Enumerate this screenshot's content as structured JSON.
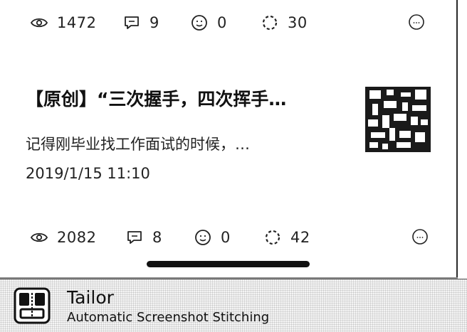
{
  "feed": {
    "top_stats": {
      "views": "1472",
      "comments": "9",
      "likes": "0",
      "shares": "30"
    },
    "article": {
      "title": "【原创】“三次握手，四次挥手…",
      "summary": "记得刚毕业找工作面试的时候，…",
      "date": "2019/1/15  11:10",
      "stats": {
        "views": "2082",
        "comments": "8",
        "likes": "0",
        "shares": "42"
      }
    }
  },
  "banner": {
    "app_name": "Tailor",
    "tagline": "Automatic Screenshot Stitching"
  },
  "icons": {
    "views": "eye-icon",
    "comments": "comment-icon",
    "likes": "smiley-icon",
    "shares": "share-icon",
    "more": "more-icon",
    "logo": "tailor-logo-icon"
  }
}
